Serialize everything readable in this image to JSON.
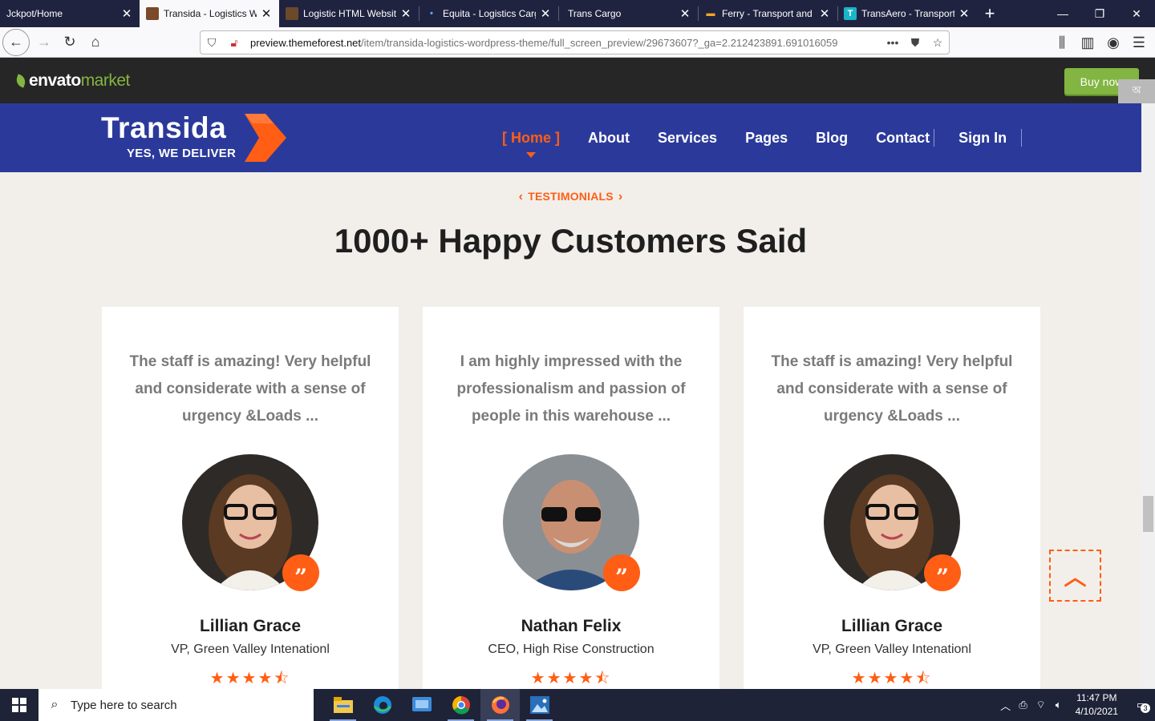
{
  "browser": {
    "tabs": [
      {
        "title": "Jckpot/Home",
        "favicon": "none",
        "active": false
      },
      {
        "title": "Transida - Logistics W",
        "favicon": "transida-favicon",
        "active": true
      },
      {
        "title": "Logistic HTML Websit",
        "favicon": "logistic-favicon",
        "active": false
      },
      {
        "title": "Equita - Logistics Carg",
        "favicon": "dot-favicon",
        "active": false
      },
      {
        "title": "Trans Cargo",
        "favicon": "none",
        "active": false
      },
      {
        "title": "Ferry - Transport and L",
        "favicon": "truck-favicon",
        "active": false
      },
      {
        "title": "TransAero - Transport",
        "favicon": "t-favicon",
        "active": false
      }
    ],
    "url_domain": "preview.themeforest.net",
    "url_path": "/item/transida-logistics-wordpress-theme/full_screen_preview/29673607?_ga=2.212423891.691016059",
    "url_more": "•••"
  },
  "envato": {
    "logo_word1": "envato",
    "logo_word2": "market",
    "buy_label": "Buy now"
  },
  "site": {
    "brand_name": "Transida",
    "brand_tagline": "YES, WE DELIVER",
    "nav": [
      "[ Home ]",
      "About",
      "Services",
      "Pages",
      "Blog",
      "Contact"
    ],
    "signin": "Sign In",
    "side_tab": "অ"
  },
  "testimonials": {
    "tag": "TESTIMONIALS",
    "title": "1000+ Happy Customers Said",
    "cards": [
      {
        "quote": "The staff is amazing! Very helpful and considerate with a sense of urgency &Loads ...",
        "name": "Lillian Grace",
        "role": "VP, Green Valley Intenationl",
        "rating": 4.5
      },
      {
        "quote": "I am highly impressed with the professionalism and passion of people in this warehouse ...",
        "name": "Nathan Felix",
        "role": "CEO, High Rise Construction",
        "rating": 4.5
      },
      {
        "quote": "The staff is amazing! Very helpful and considerate with a sense of urgency &Loads ...",
        "name": "Lillian Grace",
        "role": "VP, Green Valley Intenationl",
        "rating": 4.5
      }
    ]
  },
  "taskbar": {
    "search_placeholder": "Type here to search",
    "time": "11:47 PM",
    "date": "4/10/2021",
    "notifications": "3"
  },
  "colors": {
    "accent": "#ff5e14",
    "header_blue": "#2b3a9a",
    "envato_green": "#82b541"
  }
}
